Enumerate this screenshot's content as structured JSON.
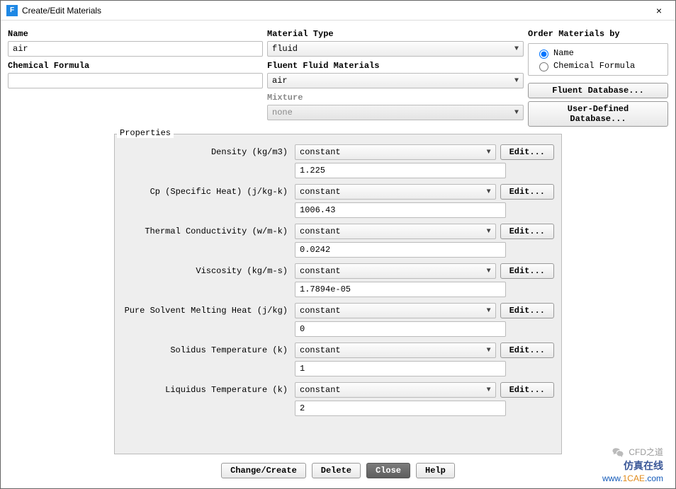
{
  "window": {
    "title": "Create/Edit Materials",
    "close": "×"
  },
  "labels": {
    "name": "Name",
    "chemical_formula": "Chemical Formula",
    "material_type": "Material Type",
    "fluent_fluid_materials": "Fluent Fluid Materials",
    "mixture": "Mixture",
    "order_by": "Order Materials by",
    "properties": "Properties"
  },
  "fields": {
    "name": "air",
    "chemical_formula": "",
    "material_type": "fluid",
    "fluent_fluid_materials": "air",
    "mixture": "none"
  },
  "order_by": {
    "name": "Name",
    "chemical_formula": "Chemical Formula",
    "selected": "name"
  },
  "buttons": {
    "fluent_db": "Fluent Database...",
    "user_db": "User-Defined Database...",
    "edit": "Edit...",
    "change_create": "Change/Create",
    "delete": "Delete",
    "close": "Close",
    "help": "Help"
  },
  "properties": [
    {
      "label": "Density (kg/m3)",
      "method": "constant",
      "value": "1.225"
    },
    {
      "label": "Cp (Specific Heat) (j/kg-k)",
      "method": "constant",
      "value": "1006.43"
    },
    {
      "label": "Thermal Conductivity (w/m-k)",
      "method": "constant",
      "value": "0.0242"
    },
    {
      "label": "Viscosity (kg/m-s)",
      "method": "constant",
      "value": "1.7894e-05"
    },
    {
      "label": "Pure Solvent Melting Heat (j/kg)",
      "method": "constant",
      "value": "0"
    },
    {
      "label": "Solidus Temperature (k)",
      "method": "constant",
      "value": "1"
    },
    {
      "label": "Liquidus Temperature (k)",
      "method": "constant",
      "value": "2"
    }
  ],
  "watermark": {
    "chat": "CFD之道",
    "brand": "仿真在线",
    "url_1": "www.",
    "url_2": "1CAE",
    "url_3": ".com"
  }
}
